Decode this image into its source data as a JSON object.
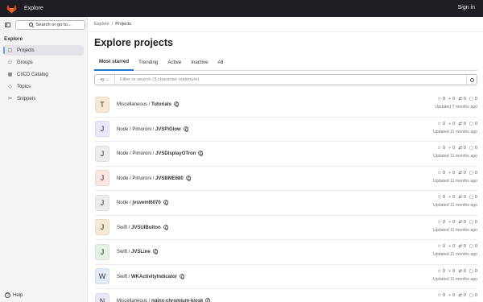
{
  "topbar": {
    "title": "Explore",
    "signin": "Sign in"
  },
  "sidebar": {
    "search_label": "Search or go to...",
    "heading": "Explore",
    "items": [
      {
        "label": "Projects",
        "icon": "projects-icon",
        "glyph": "▢",
        "active": true
      },
      {
        "label": "Groups",
        "icon": "groups-icon",
        "glyph": "⚇",
        "active": false
      },
      {
        "label": "CI/CD Catalog",
        "icon": "catalog-icon",
        "glyph": "▦",
        "active": false
      },
      {
        "label": "Topics",
        "icon": "topics-icon",
        "glyph": "◇",
        "active": false
      },
      {
        "label": "Snippets",
        "icon": "snippets-icon",
        "glyph": "✂",
        "active": false
      }
    ],
    "help": "Help"
  },
  "breadcrumb": {
    "root": "Explore",
    "separator": "/",
    "current": "Projects"
  },
  "page_title": "Explore projects",
  "tabs": [
    {
      "label": "Most starred",
      "active": true
    },
    {
      "label": "Trending",
      "active": false
    },
    {
      "label": "Active",
      "active": false
    },
    {
      "label": "Inactive",
      "active": false
    },
    {
      "label": "All",
      "active": false
    }
  ],
  "filter": {
    "placeholder": "Filter or search (3 character minimum)"
  },
  "projects": [
    {
      "avatar": "T",
      "avatar_color": "#f5e8d4",
      "namespace": "Miscellaneous / ",
      "name": "Tutorials",
      "stars": "0",
      "forks": "0",
      "mrs": "0",
      "issues": "0",
      "updated": "Updated 7 months ago"
    },
    {
      "avatar": "J",
      "avatar_color": "#e8e8f8",
      "namespace": "Node / Pimoroni / ",
      "name": "JVSPiGlow",
      "stars": "0",
      "forks": "0",
      "mrs": "0",
      "issues": "0",
      "updated": "Updated 11 months ago"
    },
    {
      "avatar": "J",
      "avatar_color": "#ececef",
      "namespace": "Node / Pimoroni / ",
      "name": "JVSDisplayOTron",
      "stars": "0",
      "forks": "0",
      "mrs": "0",
      "issues": "0",
      "updated": "Updated 11 months ago"
    },
    {
      "avatar": "J",
      "avatar_color": "#fbe5e1",
      "namespace": "Node / Pimoroni / ",
      "name": "JVSBME680",
      "stars": "0",
      "forks": "0",
      "mrs": "0",
      "issues": "0",
      "updated": "Updated 11 months ago"
    },
    {
      "avatar": "J",
      "avatar_color": "#ececef",
      "namespace": "Node / ",
      "name": "jvsveml6070",
      "stars": "0",
      "forks": "0",
      "mrs": "0",
      "issues": "0",
      "updated": "Updated 11 months ago"
    },
    {
      "avatar": "J",
      "avatar_color": "#f5e8d4",
      "namespace": "Swift / ",
      "name": "JVSUIButton",
      "stars": "0",
      "forks": "0",
      "mrs": "0",
      "issues": "0",
      "updated": "Updated 11 months ago"
    },
    {
      "avatar": "J",
      "avatar_color": "#e4f2e3",
      "namespace": "Swift / ",
      "name": "JVSLine",
      "stars": "0",
      "forks": "0",
      "mrs": "0",
      "issues": "0",
      "updated": "Updated 11 months ago"
    },
    {
      "avatar": "W",
      "avatar_color": "#e2ecf8",
      "namespace": "Swift / ",
      "name": "WKActivityIndicator",
      "stars": "0",
      "forks": "0",
      "mrs": "0",
      "issues": "0",
      "updated": "Updated 11 months ago"
    },
    {
      "avatar": "N",
      "avatar_color": "#e8e8f8",
      "namespace": "Miscellaneous / ",
      "name": "nginx-chromium-kiosk",
      "stars": "0",
      "forks": "0",
      "mrs": "0",
      "issues": "0",
      "updated": ""
    }
  ]
}
